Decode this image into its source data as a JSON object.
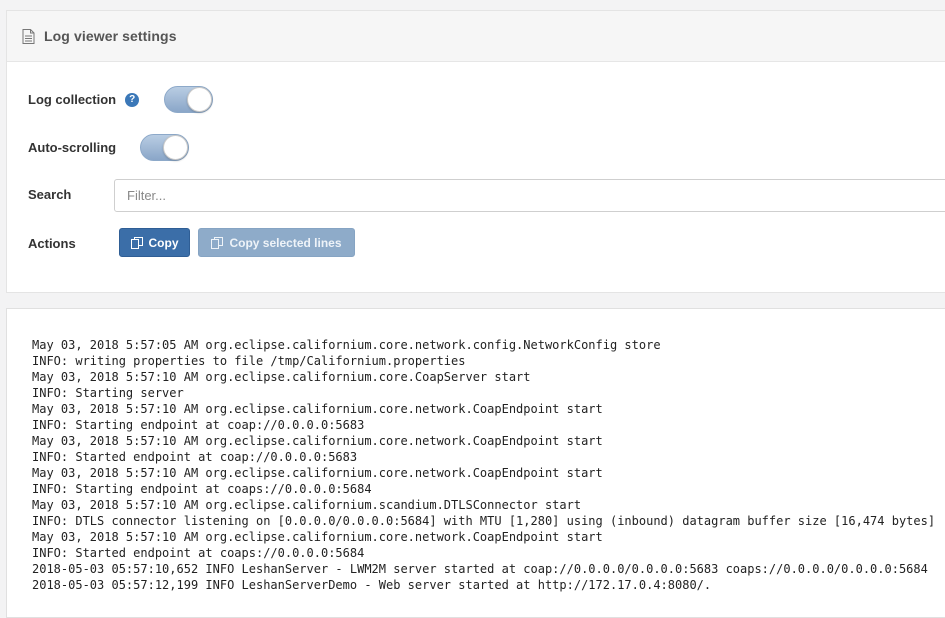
{
  "header": {
    "title": "Log viewer settings",
    "icon": "document-icon"
  },
  "settings": {
    "log_collection": {
      "label": "Log collection",
      "help": "?",
      "enabled": true
    },
    "auto_scrolling": {
      "label": "Auto-scrolling",
      "enabled": true
    },
    "search": {
      "label": "Search",
      "placeholder": "Filter...",
      "value": ""
    },
    "actions": {
      "label": "Actions",
      "copy": "Copy",
      "copy_selected": "Copy selected lines"
    }
  },
  "colors": {
    "accent": "#3b6ea8",
    "toggle_on": "#9bb3d1",
    "help": "#3b78b8"
  },
  "log_lines": [
    "May 03, 2018 5:57:05 AM org.eclipse.californium.core.network.config.NetworkConfig store",
    "INFO: writing properties to file /tmp/Californium.properties",
    "May 03, 2018 5:57:10 AM org.eclipse.californium.core.CoapServer start",
    "INFO: Starting server",
    "May 03, 2018 5:57:10 AM org.eclipse.californium.core.network.CoapEndpoint start",
    "INFO: Starting endpoint at coap://0.0.0.0:5683",
    "May 03, 2018 5:57:10 AM org.eclipse.californium.core.network.CoapEndpoint start",
    "INFO: Started endpoint at coap://0.0.0.0:5683",
    "May 03, 2018 5:57:10 AM org.eclipse.californium.core.network.CoapEndpoint start",
    "INFO: Starting endpoint at coaps://0.0.0.0:5684",
    "May 03, 2018 5:57:10 AM org.eclipse.californium.scandium.DTLSConnector start",
    "INFO: DTLS connector listening on [0.0.0.0/0.0.0.0:5684] with MTU [1,280] using (inbound) datagram buffer size [16,474 bytes]",
    "May 03, 2018 5:57:10 AM org.eclipse.californium.core.network.CoapEndpoint start",
    "INFO: Started endpoint at coaps://0.0.0.0:5684",
    "2018-05-03 05:57:10,652 INFO LeshanServer - LWM2M server started at coap://0.0.0.0/0.0.0.0:5683 coaps://0.0.0.0/0.0.0.0:5684",
    "2018-05-03 05:57:12,199 INFO LeshanServerDemo - Web server started at http://172.17.0.4:8080/."
  ]
}
